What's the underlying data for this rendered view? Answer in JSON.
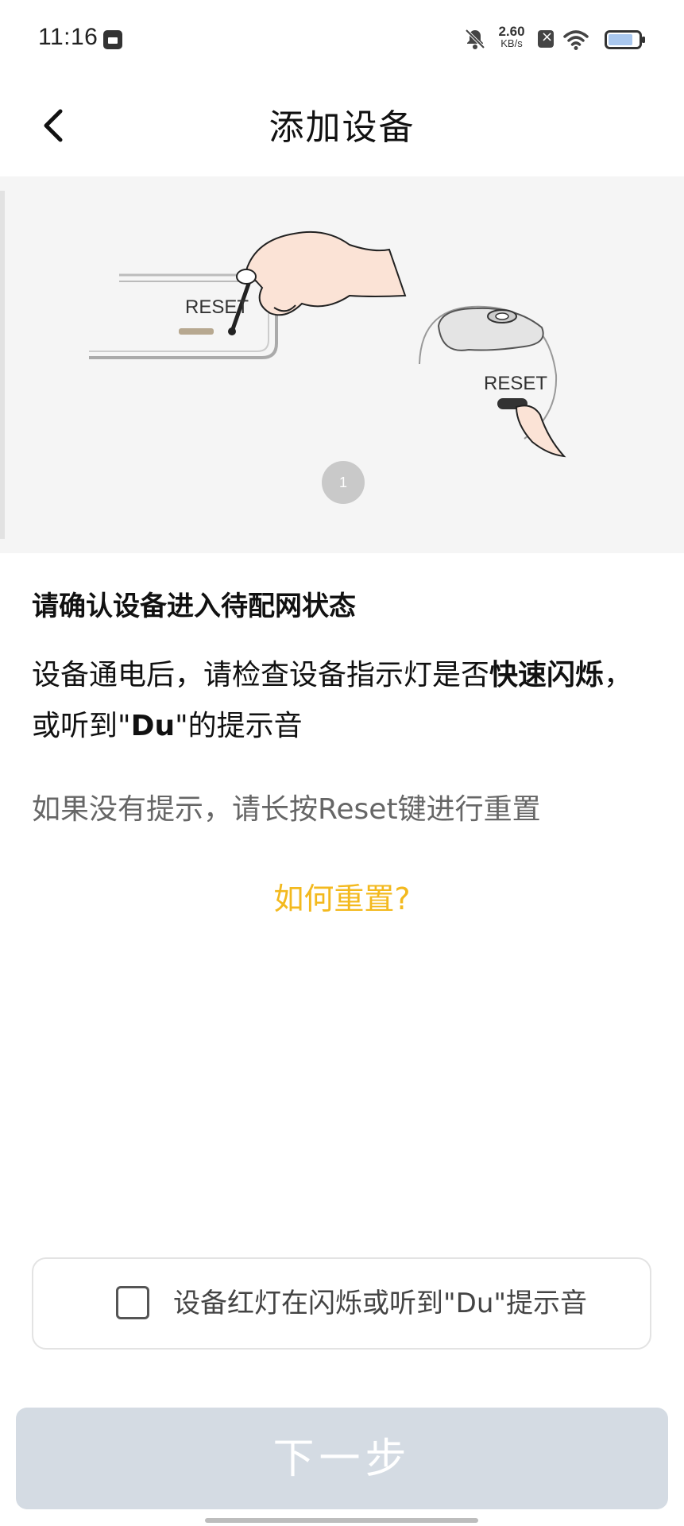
{
  "status_bar": {
    "time": "11:16",
    "net_speed_value": "2.60",
    "net_speed_unit": "KB/s"
  },
  "header": {
    "title": "添加设备"
  },
  "illustration": {
    "label_left": "RESET",
    "label_right": "RESET",
    "page_indicator": "1"
  },
  "content": {
    "heading": "请确认设备进入待配网状态",
    "desc_part1": "设备通电后，请检查设备指示灯是否",
    "desc_bold": "快速闪烁",
    "desc_part2": "，或听到\"",
    "desc_du": "Du",
    "desc_part3": "\"的提示音",
    "hint": "如果没有提示，请长按Reset键进行重置",
    "reset_link": "如何重置?"
  },
  "confirm": {
    "label": "设备红灯在闪烁或听到\"Du\"提示音",
    "checked": false
  },
  "footer": {
    "next_label": "下一步"
  },
  "colors": {
    "link": "#f3b91e",
    "button_disabled": "#d4dbe3"
  }
}
